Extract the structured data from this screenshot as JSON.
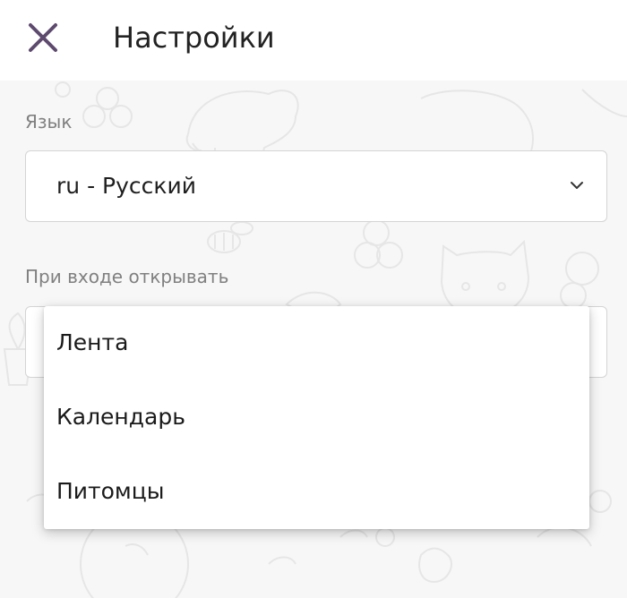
{
  "header": {
    "title": "Настройки",
    "close_icon": "close-icon"
  },
  "settings": {
    "language": {
      "label": "Язык",
      "value": "ru - Русский",
      "icon": "chevron-down-icon"
    },
    "open_on_start": {
      "label": "При входе открывать",
      "options": [
        "Лента",
        "Календарь",
        "Питомцы"
      ]
    }
  },
  "colors": {
    "accent": "#5e4a6e",
    "label": "#808080",
    "text": "#1f1f1f"
  }
}
